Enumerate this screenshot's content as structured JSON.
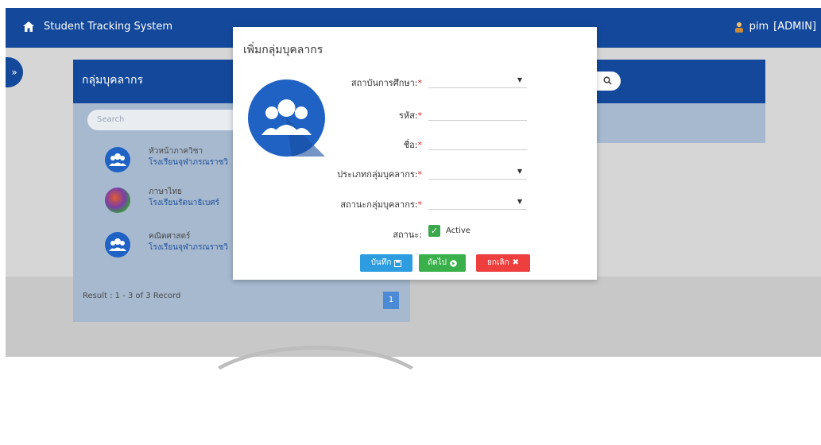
{
  "navbar": {
    "brand": "Student Tracking System",
    "user": "pim",
    "role": "[ADMIN]"
  },
  "sidebar_toggle": "»",
  "panel": {
    "title": "กลุ่มบุคลากร",
    "search_placeholder": "Search",
    "items": [
      {
        "title": "หัวหน้าภาควิชา",
        "subtitle": "โรงเรียนจุฬาภรณราชวิ"
      },
      {
        "title": "ภาษาไทย",
        "subtitle": "โรงเรียนรัตนาธิเบศร์"
      },
      {
        "title": "คณิตศาสตร์",
        "subtitle": "โรงเรียนจุฬาภรณราชวิ"
      }
    ],
    "result": "Result : 1 - 3 of 3 Record",
    "page": "1"
  },
  "modal": {
    "title": "เพิ่มกลุ่มบุคลากร",
    "fields": {
      "institution": "สถาบันการศึกษา:",
      "code": "รหัส:",
      "name": "ชื่อ:",
      "group_type": "ประเภทกลุ่มบุคลากร:",
      "group_status": "สถานะกลุ่มบุคลากร:",
      "status": "สถานะ:"
    },
    "required_mark": "*",
    "status_checkbox": "Active",
    "buttons": {
      "save": "บันทึก",
      "next": "ถัดไป",
      "cancel": "ยกเลิก"
    }
  },
  "colors": {
    "navbar": "#13489a",
    "panel": "#a6b9cf",
    "save": "#2d9de0",
    "next": "#3ab04a",
    "cancel": "#ee3e3e"
  }
}
